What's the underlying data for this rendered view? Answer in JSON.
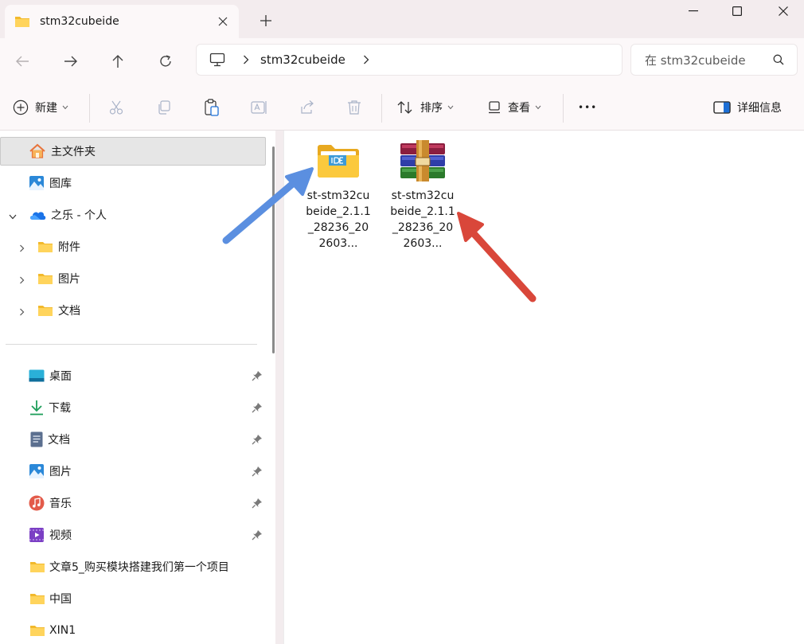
{
  "window": {
    "tab_title": "stm32cubeide",
    "new_tab_glyph": "+",
    "controls": [
      "minimize-icon",
      "maximize-icon",
      "close-icon"
    ]
  },
  "nav": {
    "breadcrumb": "stm32cubeide",
    "search_placeholder": "在 stm32cubeide"
  },
  "toolbar": {
    "new_label": "新建",
    "sort_label": "排序",
    "view_label": "查看",
    "more_glyph": "•••",
    "details_label": "详细信息"
  },
  "sidebar": {
    "home": "主文件夹",
    "gallery": "图库",
    "onedrive": "之乐 - 个人",
    "onedrive_children": [
      "附件",
      "图片",
      "文档"
    ],
    "quick_access": [
      {
        "label": "桌面",
        "icon": "desktop-icon",
        "pinned": true
      },
      {
        "label": "下载",
        "icon": "download-icon",
        "pinned": true
      },
      {
        "label": "文档",
        "icon": "document-icon",
        "pinned": true
      },
      {
        "label": "图片",
        "icon": "pictures-icon",
        "pinned": true
      },
      {
        "label": "音乐",
        "icon": "music-icon",
        "pinned": true
      },
      {
        "label": "视频",
        "icon": "video-icon",
        "pinned": true
      },
      {
        "label": "文章5_购买模块搭建我们第一个项目",
        "icon": "folder-icon",
        "pinned": false
      },
      {
        "label": "中国",
        "icon": "folder-icon",
        "pinned": false
      },
      {
        "label": "XIN1",
        "icon": "folder-icon",
        "pinned": false
      }
    ]
  },
  "files": [
    {
      "name": "st-stm32cubeide_2.1.1_28236_202603...",
      "icon": "ide-folder-icon"
    },
    {
      "name": "st-stm32cubeide_2.1.1_28236_202603...",
      "icon": "winrar-archive-icon"
    }
  ],
  "colors": {
    "accent_blue": "#5b8fe0",
    "accent_red": "#d9473a",
    "folder_yellow": "#f7c948"
  }
}
